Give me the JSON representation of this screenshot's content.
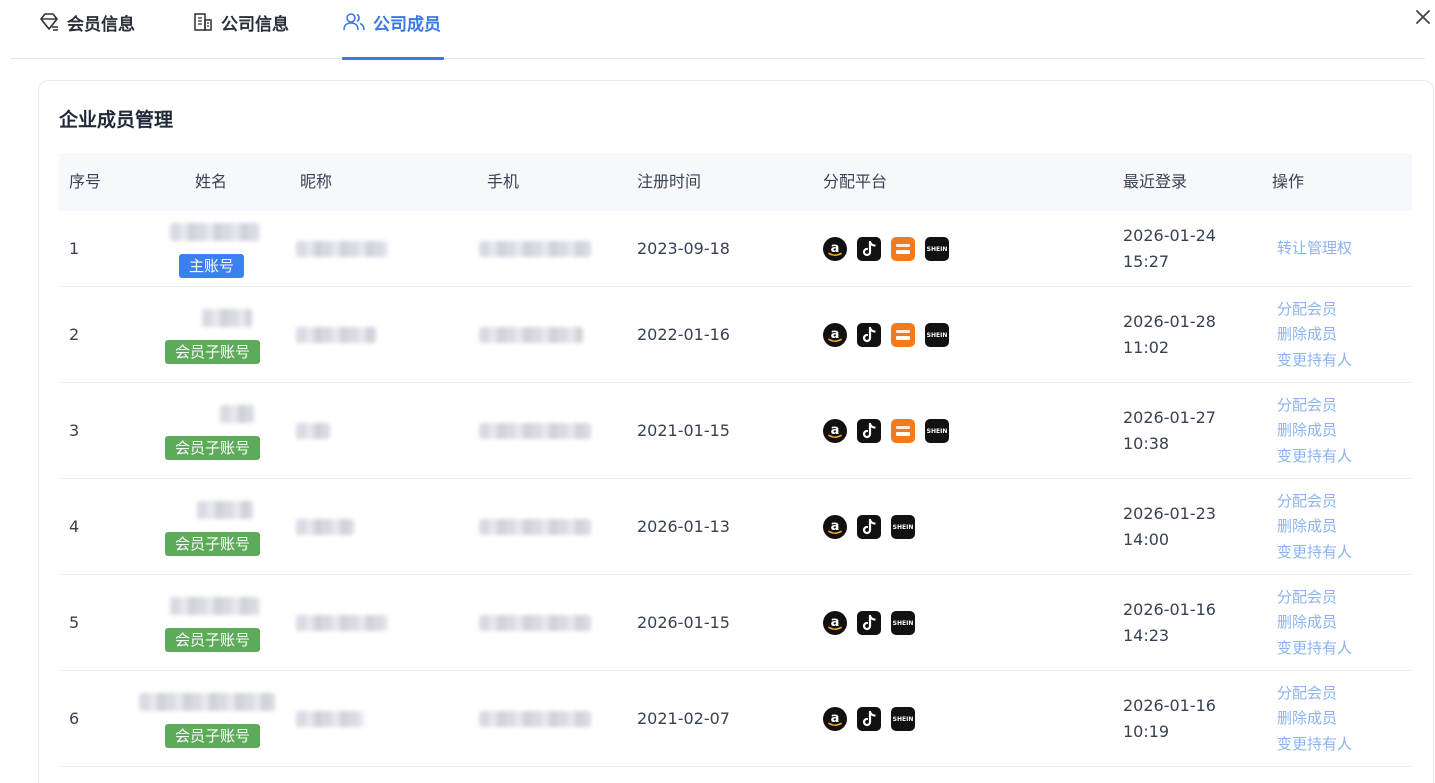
{
  "tabs": [
    {
      "label": "会员信息",
      "icon": "diamond-icon",
      "active": false
    },
    {
      "label": "公司信息",
      "icon": "building-icon",
      "active": false
    },
    {
      "label": "公司成员",
      "icon": "users-icon",
      "active": true
    }
  ],
  "card": {
    "title": "企业成员管理",
    "columns": [
      "序号",
      "姓名",
      "昵称",
      "手机",
      "注册时间",
      "分配平台",
      "最近登录",
      "操作"
    ]
  },
  "rows": [
    {
      "seq": "1",
      "badge": "主账号",
      "badge_type": "main",
      "registered": "2023-09-18",
      "platforms": [
        "amazon",
        "tiktok",
        "temu",
        "shein"
      ],
      "login_date": "2026-01-24",
      "login_time": "15:27",
      "actions": [
        "转让管理权"
      ]
    },
    {
      "seq": "2",
      "badge": "会员子账号",
      "badge_type": "sub",
      "registered": "2022-01-16",
      "platforms": [
        "amazon",
        "tiktok",
        "temu",
        "shein"
      ],
      "login_date": "2026-01-28",
      "login_time": "11:02",
      "actions": [
        "分配会员",
        "删除成员",
        "变更持有人"
      ]
    },
    {
      "seq": "3",
      "badge": "会员子账号",
      "badge_type": "sub",
      "registered": "2021-01-15",
      "platforms": [
        "amazon",
        "tiktok",
        "temu",
        "shein"
      ],
      "login_date": "2026-01-27",
      "login_time": "10:38",
      "actions": [
        "分配会员",
        "删除成员",
        "变更持有人"
      ]
    },
    {
      "seq": "4",
      "badge": "会员子账号",
      "badge_type": "sub",
      "registered": "2026-01-13",
      "platforms": [
        "amazon",
        "tiktok",
        "shein"
      ],
      "login_date": "2026-01-23",
      "login_time": "14:00",
      "actions": [
        "分配会员",
        "删除成员",
        "变更持有人"
      ]
    },
    {
      "seq": "5",
      "badge": "会员子账号",
      "badge_type": "sub",
      "registered": "2026-01-15",
      "platforms": [
        "amazon",
        "tiktok",
        "shein"
      ],
      "login_date": "2026-01-16",
      "login_time": "14:23",
      "actions": [
        "分配会员",
        "删除成员",
        "变更持有人"
      ]
    },
    {
      "seq": "6",
      "badge": "会员子账号",
      "badge_type": "sub",
      "registered": "2021-02-07",
      "platforms": [
        "amazon",
        "tiktok",
        "shein"
      ],
      "login_date": "2026-01-16",
      "login_time": "10:19",
      "actions": [
        "分配会员",
        "删除成员",
        "变更持有人"
      ]
    }
  ],
  "platform_labels": {
    "shein": "SHEIN"
  },
  "colors": {
    "accent": "#3a78e6",
    "link": "#8ab4f0",
    "badge_main": "#3b7ff0",
    "badge_sub": "#5daa5a",
    "temu": "#f07a1c"
  }
}
